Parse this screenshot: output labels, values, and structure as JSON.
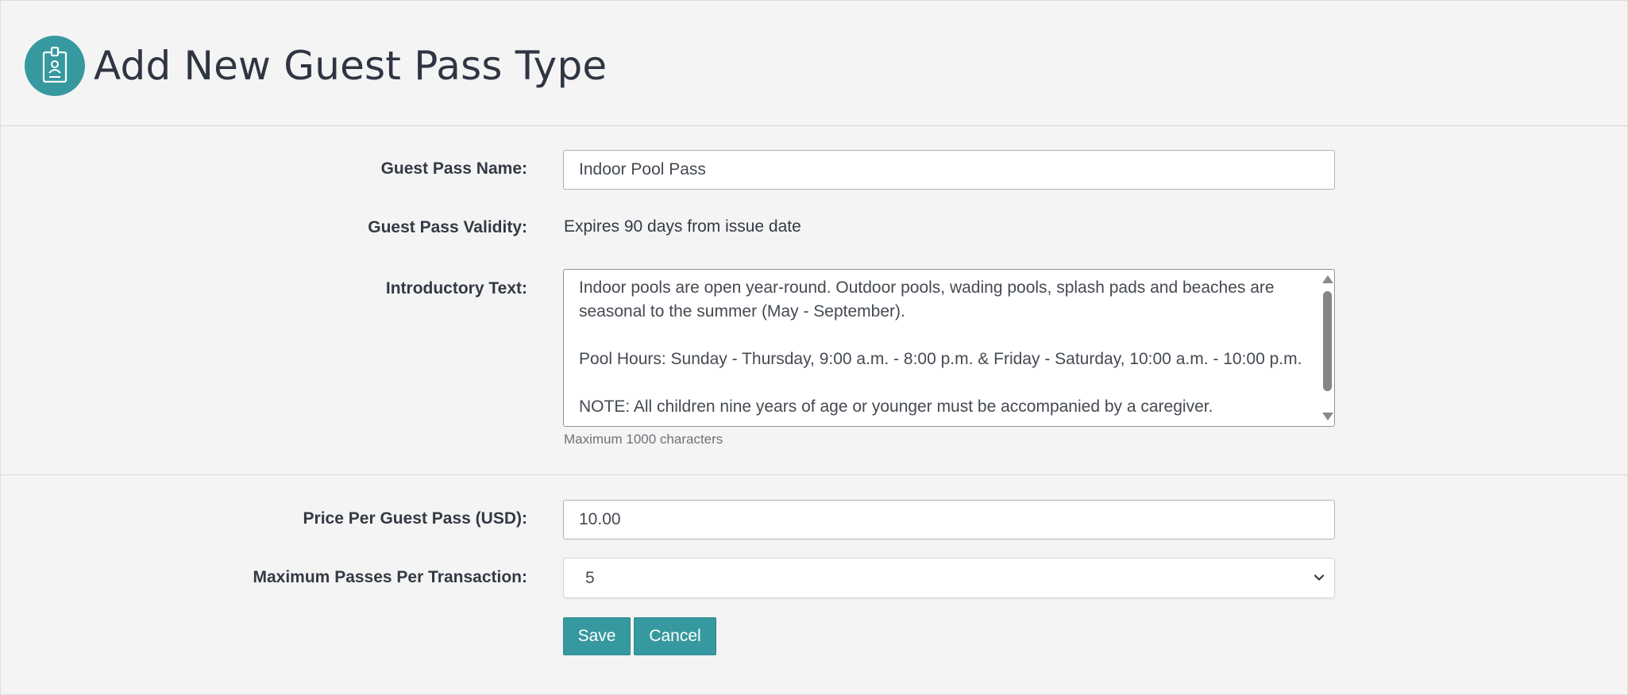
{
  "header": {
    "title": "Add New Guest Pass Type",
    "icon": "id-badge-icon",
    "icon_bg_color": "#36999f"
  },
  "form": {
    "name": {
      "label": "Guest Pass Name:",
      "value": "Indoor Pool Pass"
    },
    "validity": {
      "label": "Guest Pass Validity:",
      "value": "Expires 90 days from issue date"
    },
    "intro": {
      "label": "Introductory Text:",
      "paragraphs": [
        "Indoor pools are open year-round. Outdoor pools, wading pools, splash pads and beaches are seasonal to the summer (May - September).",
        "Pool Hours: Sunday - Thursday, 9:00 a.m. - 8:00 p.m. & Friday - Saturday, 10:00 a.m. - 10:00 p.m.",
        "NOTE: All children nine years of age or younger must be accompanied by a caregiver."
      ],
      "help": "Maximum 1000 characters"
    },
    "price": {
      "label": "Price Per Guest Pass (USD):",
      "value": "10.00"
    },
    "max_passes": {
      "label": "Maximum Passes Per Transaction:",
      "selected": "5"
    }
  },
  "actions": {
    "save_label": "Save",
    "cancel_label": "Cancel",
    "button_color": "#36999f"
  }
}
